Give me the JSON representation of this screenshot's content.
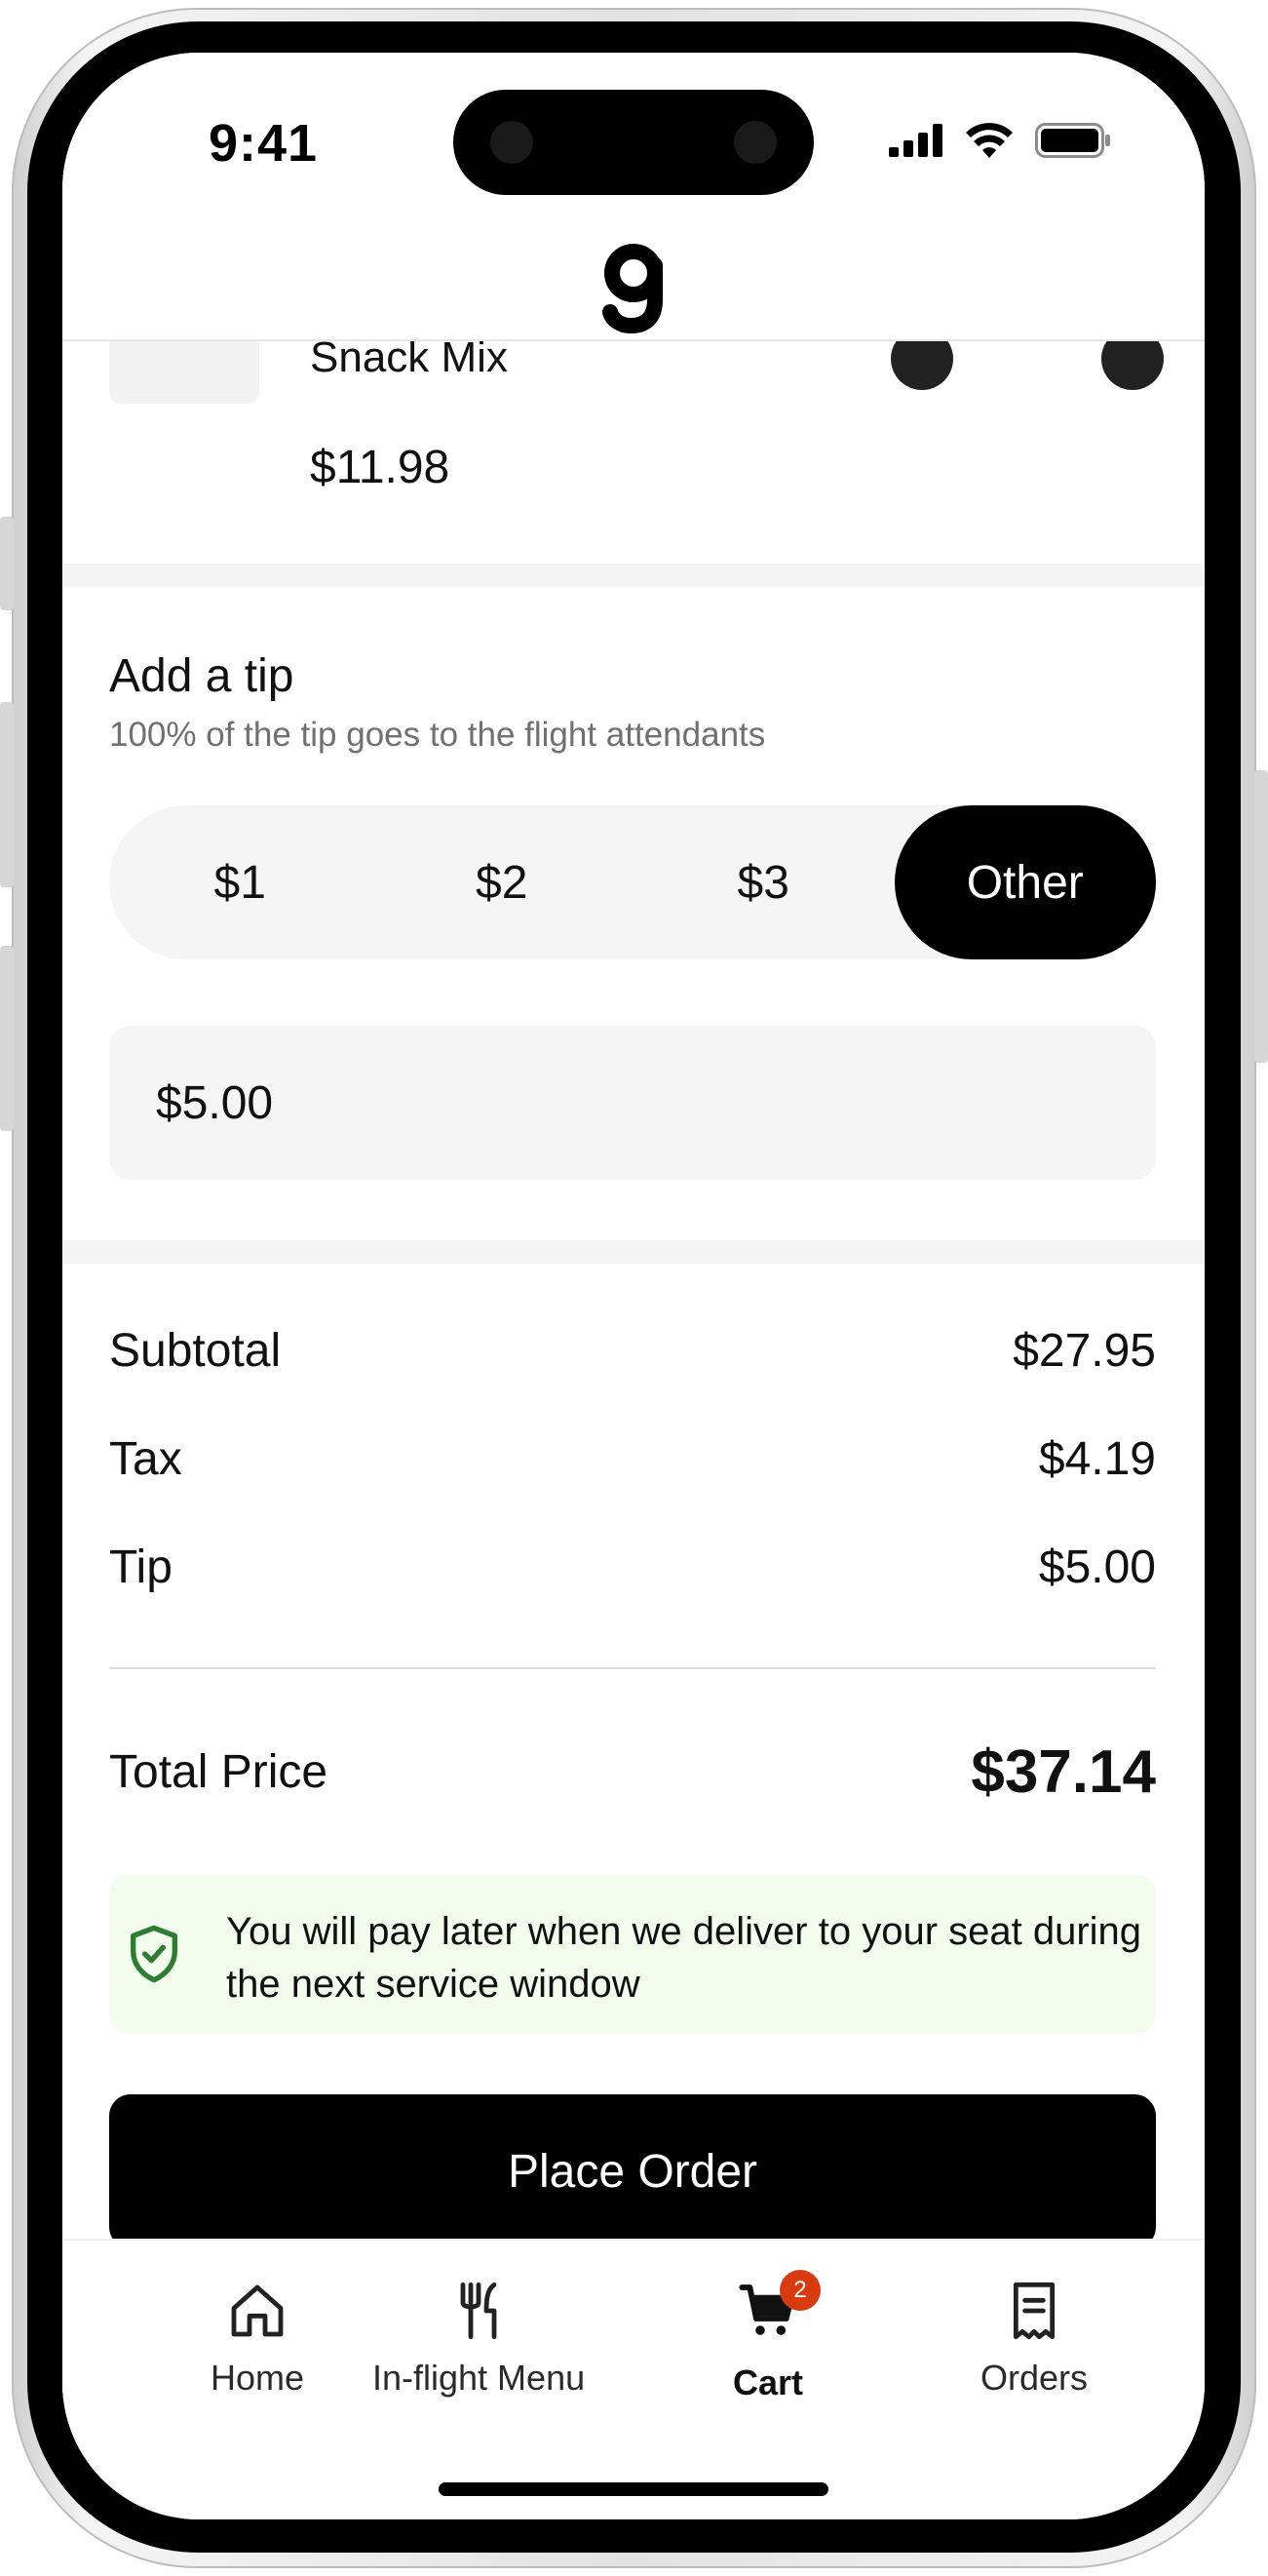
{
  "status_bar": {
    "time": "9:41"
  },
  "cart_item": {
    "name": "Snack Mix",
    "price": "$11.98"
  },
  "tip": {
    "title": "Add a tip",
    "subtitle": "100% of the tip goes to the flight attendants",
    "options": [
      "$1",
      "$2",
      "$3",
      "Other"
    ],
    "selected": "Other",
    "custom_value": "$5.00"
  },
  "summary": {
    "subtotal_label": "Subtotal",
    "subtotal_value": "$27.95",
    "tax_label": "Tax",
    "tax_value": "$4.19",
    "tip_label": "Tip",
    "tip_value": "$5.00",
    "total_label": "Total Price",
    "total_value": "$37.14"
  },
  "notice": {
    "text": "You will pay later when we deliver to your seat during the next service window"
  },
  "cta": {
    "place_order": "Place Order"
  },
  "tab_bar": {
    "home": "Home",
    "menu": "In-flight Menu",
    "cart": "Cart",
    "cart_badge": "2",
    "orders": "Orders",
    "active": "Cart"
  },
  "colors": {
    "accent": "#000000",
    "badge": "#d93b10",
    "notice_bg": "#f2fdee",
    "notice_icon": "#2e7d32"
  }
}
